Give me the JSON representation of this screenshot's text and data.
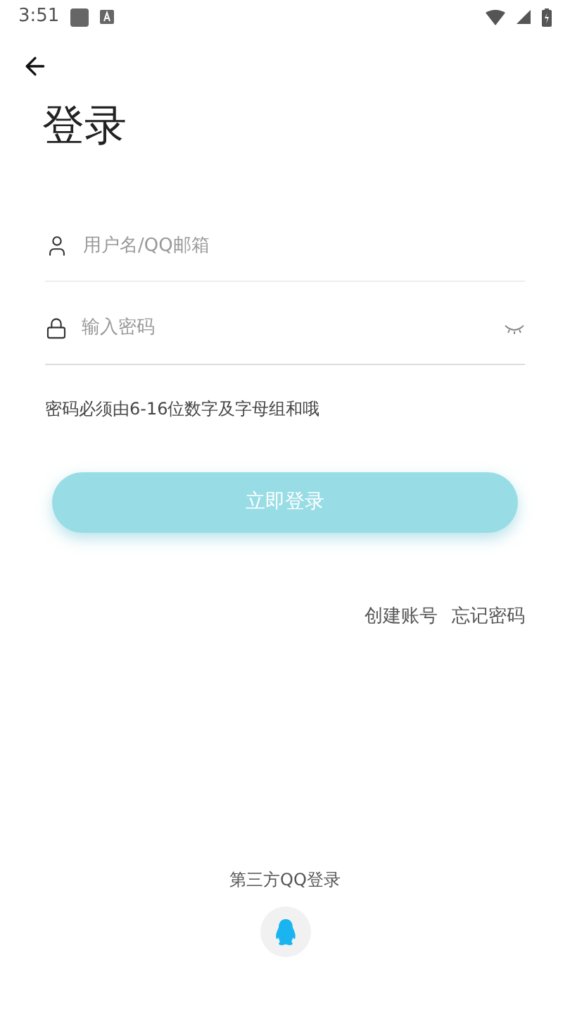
{
  "status_bar": {
    "time": "3:51"
  },
  "title": "登录",
  "username": {
    "placeholder": "用户名/QQ邮箱"
  },
  "password": {
    "placeholder": "输入密码",
    "visible": false
  },
  "hint": "密码必须由6-16位数字及字母组和哦",
  "login_button": {
    "label": "立即登录",
    "disabled": true
  },
  "links": [
    "创建账号",
    "忘记密码"
  ],
  "third_party": {
    "label": "第三方QQ登录"
  }
}
